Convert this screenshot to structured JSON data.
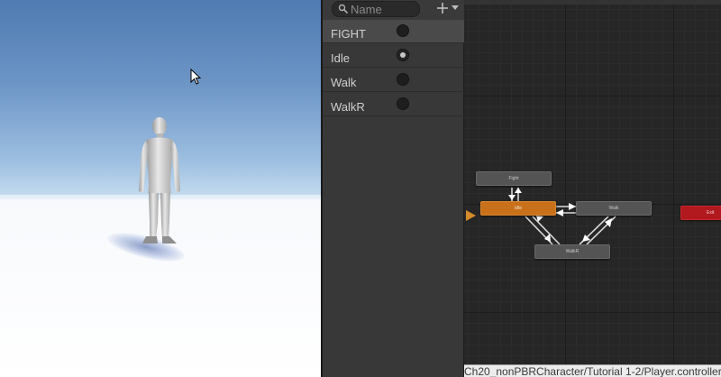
{
  "scene": {
    "icons": {
      "cursor": "mouse-pointer-icon"
    }
  },
  "parameters": {
    "search_placeholder": "Name",
    "add_icon": "plus-icon",
    "dropdown_icon": "chevron-down-icon",
    "items": [
      {
        "name": "FIGHT",
        "value": false
      },
      {
        "name": "Idle",
        "value": true
      },
      {
        "name": "Walk",
        "value": false
      },
      {
        "name": "WalkR",
        "value": false
      }
    ]
  },
  "graph": {
    "states": {
      "fight": "Fight",
      "idle": "Idle",
      "walk": "Walk",
      "walkr": "WalkR",
      "exit": "Exit"
    },
    "default_state_color": "#c8701a",
    "exit_color": "#b1191e",
    "breadcrumb": "Ch20_nonPBRCharacter/Tutorial 1-2/Player.controller"
  }
}
